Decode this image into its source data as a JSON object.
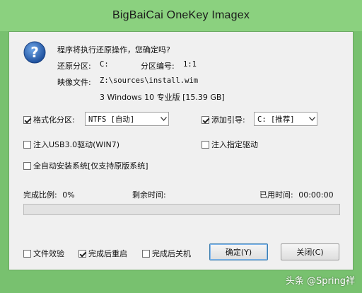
{
  "window": {
    "title": "BigBaiCai OneKey Imagex"
  },
  "colors": {
    "frame": "#78c16f",
    "title_bar": "#8bd17f",
    "progress_fill": "#06b025",
    "dialog_bg": "#f0f0f0"
  },
  "prompt": {
    "icon": "question-icon",
    "question": "程序将执行还原操作，您确定吗?",
    "restore_partition_label": "还原分区:",
    "restore_partition_value": "C:",
    "partition_number_label": "分区编号:",
    "partition_number_value": "1:1",
    "image_file_label": "映像文件:",
    "image_file_value": "Z:\\sources\\install.wim",
    "image_detail": "3 Windows 10 专业版 [15.39 GB]"
  },
  "options": {
    "format_partition": {
      "label": "格式化分区:",
      "checked": true,
      "select_value": "NTFS [自动]"
    },
    "add_boot": {
      "label": "添加引导:",
      "checked": true,
      "select_value": "C: [推荐]"
    },
    "inject_usb3": {
      "label": "注入USB3.0驱动(WIN7)",
      "checked": false
    },
    "inject_driver": {
      "label": "注入指定驱动",
      "checked": false
    },
    "auto_install": {
      "label": "全自动安装系统[仅支持原版系统]",
      "checked": false
    }
  },
  "status": {
    "completion_label": "完成比例:",
    "completion_value": "0%",
    "remaining_label": "剩余时间:",
    "remaining_value": "",
    "elapsed_label": "已用时间:",
    "elapsed_value": "00:00:00",
    "progress": 0
  },
  "bottom": {
    "verify_file": {
      "label": "文件效验",
      "checked": false
    },
    "restart_after": {
      "label": "完成后重启",
      "checked": true
    },
    "shutdown_after": {
      "label": "完成后关机",
      "checked": false
    },
    "ok_label": "确定(Y)",
    "close_label": "关闭(C)"
  },
  "watermark": "头条 @Spring祥"
}
